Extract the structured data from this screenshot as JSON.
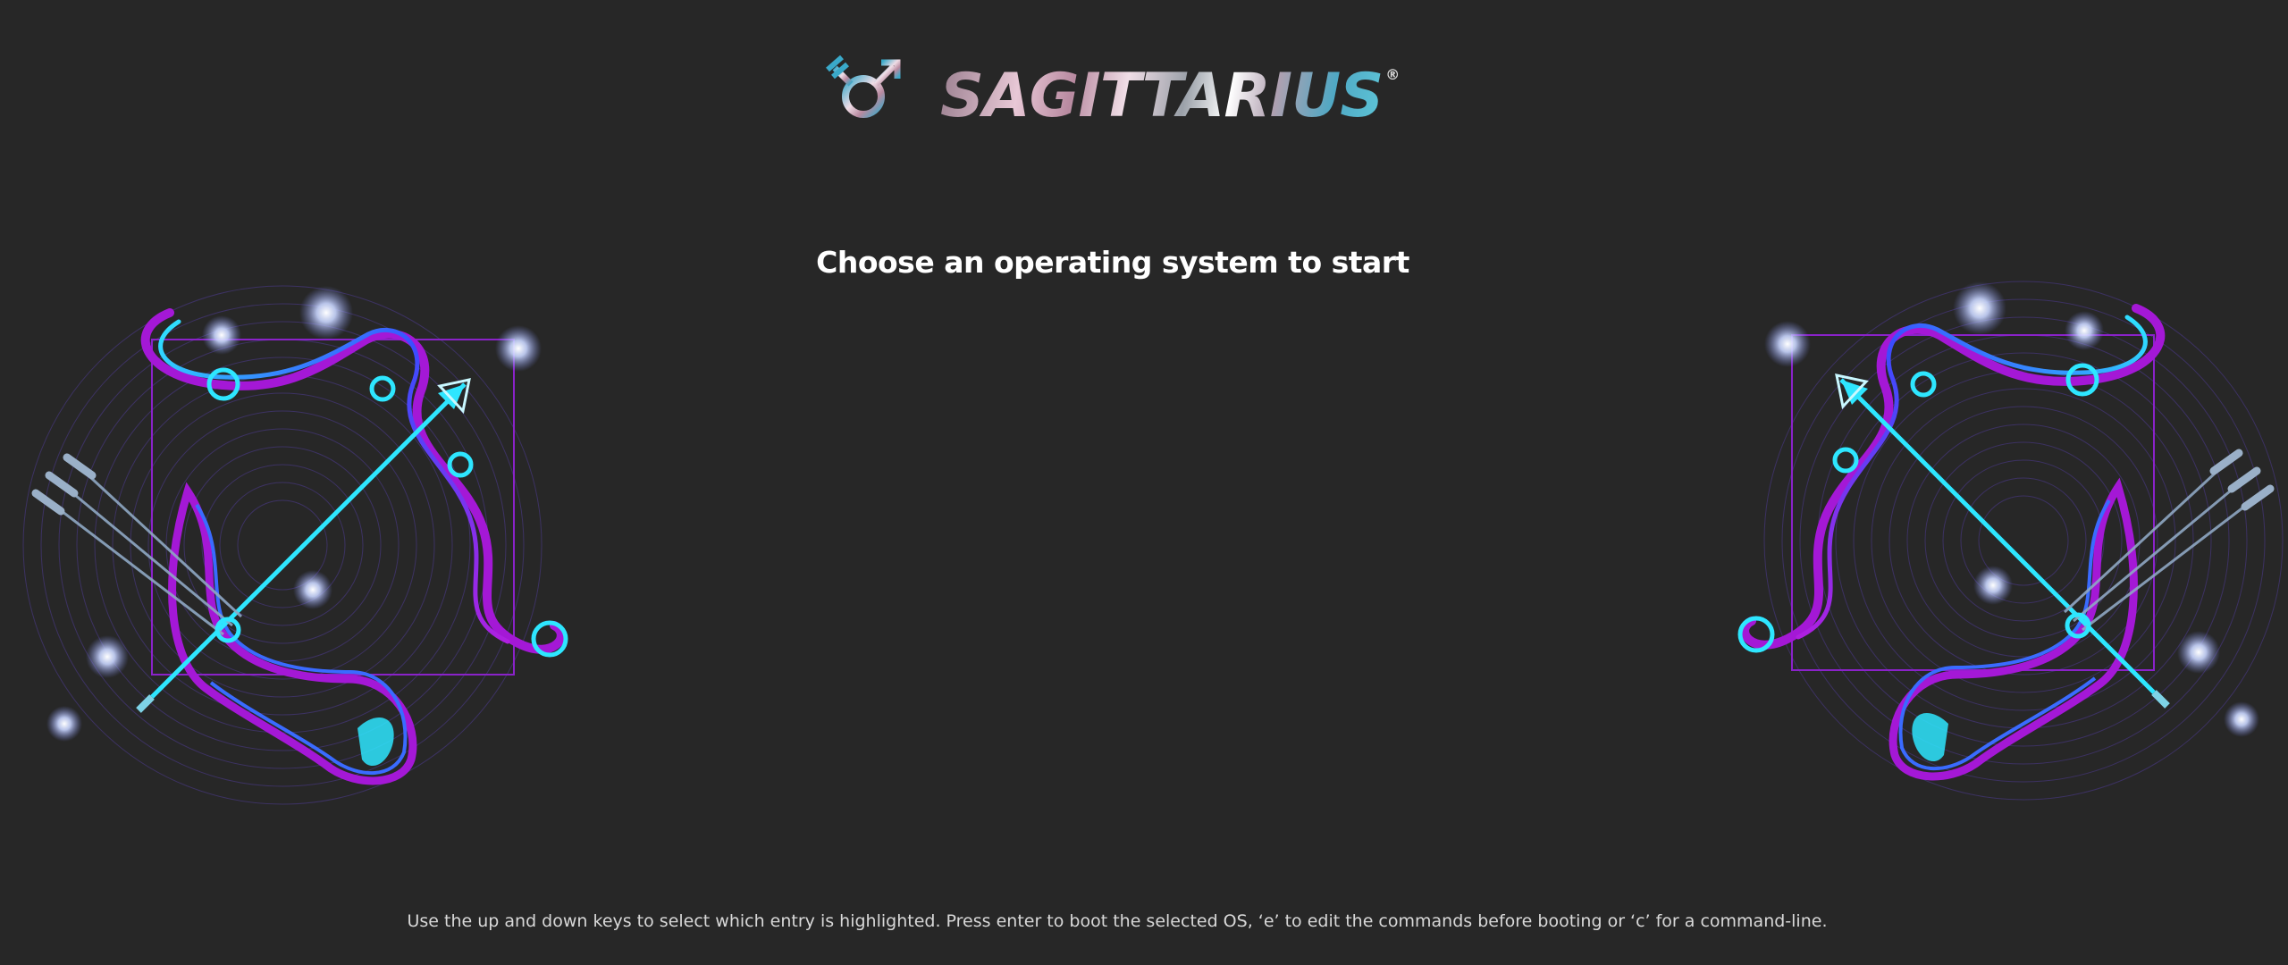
{
  "brand": {
    "name": "SAGITTARIUS",
    "registered_mark": "®",
    "symbol_icon": "transgender-symbol-icon"
  },
  "boot_menu": {
    "heading": "Choose an operating system to start",
    "entries": []
  },
  "help_text": "Use the up and down keys to select which entry is highlighted. Press enter to boot the selected OS, ‘e’ to edit the commands before booting or ‘c’ for a command-line.",
  "decorations": {
    "left": "sagittarius-bow-and-arrow-art",
    "right": "sagittarius-bow-and-arrow-art"
  },
  "colors": {
    "background": "#272727",
    "text": "#ffffff",
    "help_text": "#d8d8d8",
    "accent_cyan": "#2ee6ff",
    "accent_purple": "#9b1fd6",
    "accent_blue": "#3a4dff"
  }
}
